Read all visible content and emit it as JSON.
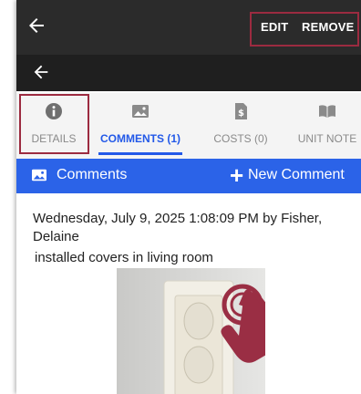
{
  "header": {
    "edit_label": "EDIT",
    "remove_label": "REMOVE"
  },
  "tabs": [
    {
      "label": "DETAILS",
      "icon": "info-icon"
    },
    {
      "label": "COMMENTS (1)",
      "icon": "image-icon"
    },
    {
      "label": "COSTS (0)",
      "icon": "dollar-document-icon"
    },
    {
      "label": "UNIT NOTE",
      "icon": "book-icon"
    }
  ],
  "section": {
    "title": "Comments",
    "new_label": "New Comment",
    "plus_symbol": "+"
  },
  "comment": {
    "meta": "Wednesday, July 9, 2025 1:08:09 PM by Fisher, Delaine",
    "text": "installed covers in living room"
  },
  "colors": {
    "accent": "#2b63e8",
    "highlight": "#9c2b40",
    "topbar": "#2b2b2b"
  }
}
